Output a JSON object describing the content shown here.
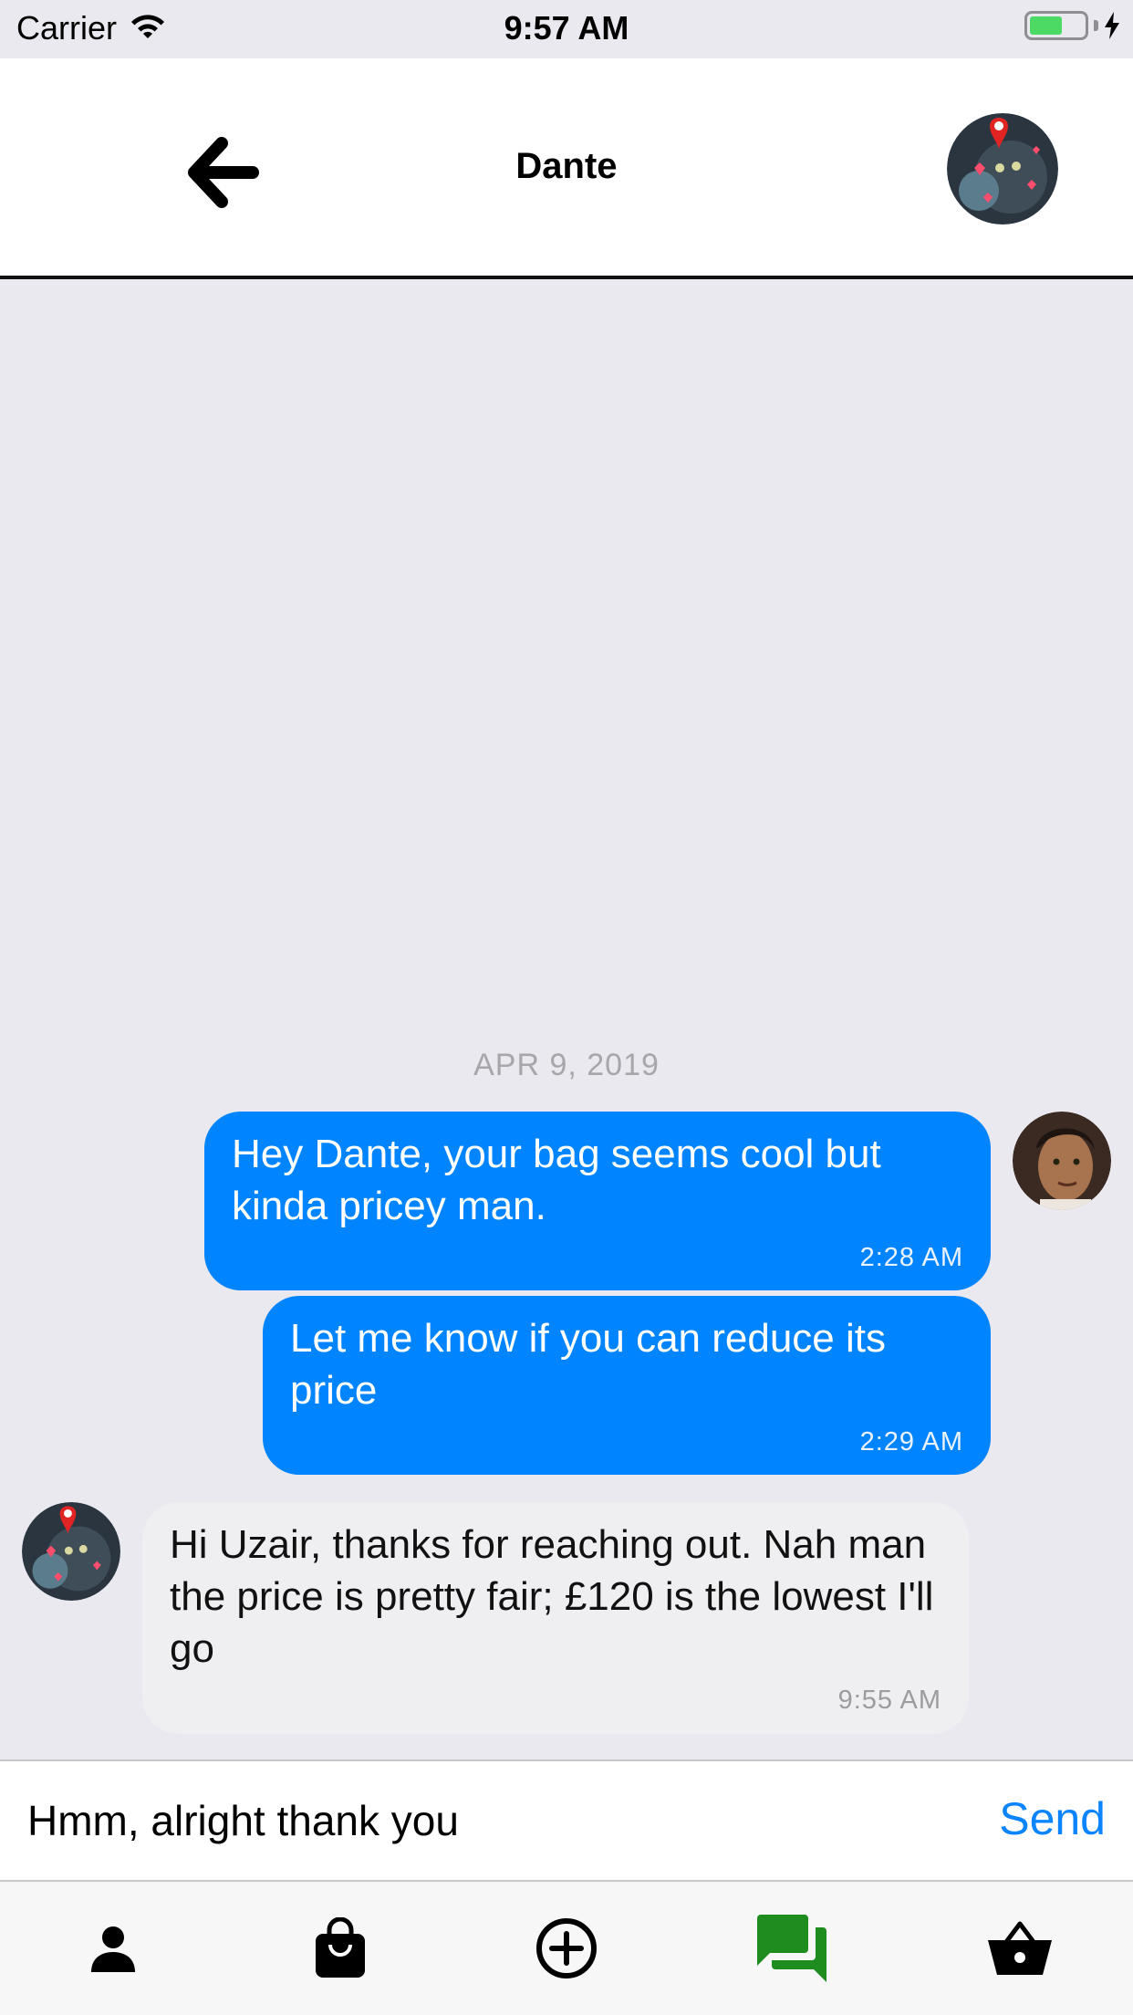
{
  "status_bar": {
    "carrier": "Carrier",
    "time": "9:57 AM",
    "icons": [
      "wifi-icon",
      "battery-icon",
      "charging-bolt-icon"
    ],
    "battery_color": "#4cd964"
  },
  "nav": {
    "title": "Dante",
    "back_icon": "arrow-left-icon",
    "avatar": "dante-avatar"
  },
  "chat": {
    "date": "APR 9, 2019",
    "messages": [
      {
        "direction": "outgoing",
        "text": "Hey Dante, your bag seems cool but kinda pricey man.",
        "time": "2:28 AM"
      },
      {
        "direction": "outgoing",
        "text": "Let me know if you can reduce its price",
        "time": "2:29 AM"
      },
      {
        "direction": "incoming",
        "text": "Hi Uzair, thanks for reaching out. Nah man the price is pretty fair; £120 is the lowest I'll go",
        "time": "9:55 AM"
      }
    ]
  },
  "composer": {
    "value": "Hmm, alright thank you",
    "send_label": "Send"
  },
  "tabs": [
    {
      "icon": "profile-icon",
      "active": false
    },
    {
      "icon": "shopping-bag-icon",
      "active": false
    },
    {
      "icon": "add-circle-icon",
      "active": false
    },
    {
      "icon": "chat-icon",
      "active": true
    },
    {
      "icon": "basket-icon",
      "active": false
    }
  ],
  "colors": {
    "outgoing_bubble": "#0084ff",
    "incoming_bubble": "#efeff2",
    "send": "#0a84ff",
    "active_tab": "#1e8c1e"
  }
}
